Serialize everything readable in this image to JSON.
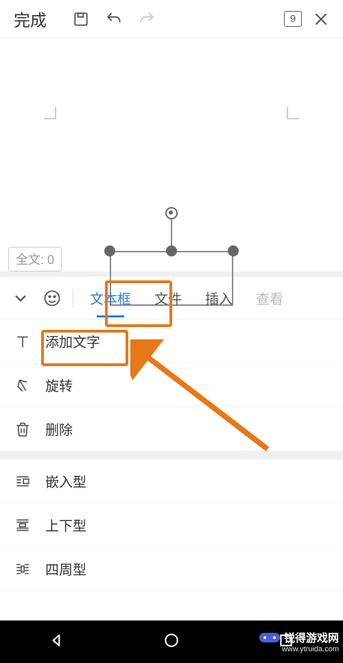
{
  "header": {
    "done_label": "完成",
    "page_number": "9"
  },
  "word_count": "全文: 0",
  "tabs": {
    "items": [
      "文本框",
      "文件",
      "插入",
      "查看"
    ],
    "active_index": 0
  },
  "menu_group1": [
    {
      "icon": "text-icon",
      "label": "添加文字"
    },
    {
      "icon": "rotate-icon",
      "label": "旋转"
    },
    {
      "icon": "trash-icon",
      "label": "删除"
    }
  ],
  "menu_group2": [
    {
      "icon": "wrap-inline-icon",
      "label": "嵌入型"
    },
    {
      "icon": "wrap-topbottom-icon",
      "label": "上下型"
    },
    {
      "icon": "wrap-square-icon",
      "label": "四周型"
    }
  ],
  "highlight": {
    "color": "#e67817"
  },
  "watermark": {
    "brand": "锐得游戏网",
    "url": "www.ytruida.com"
  }
}
